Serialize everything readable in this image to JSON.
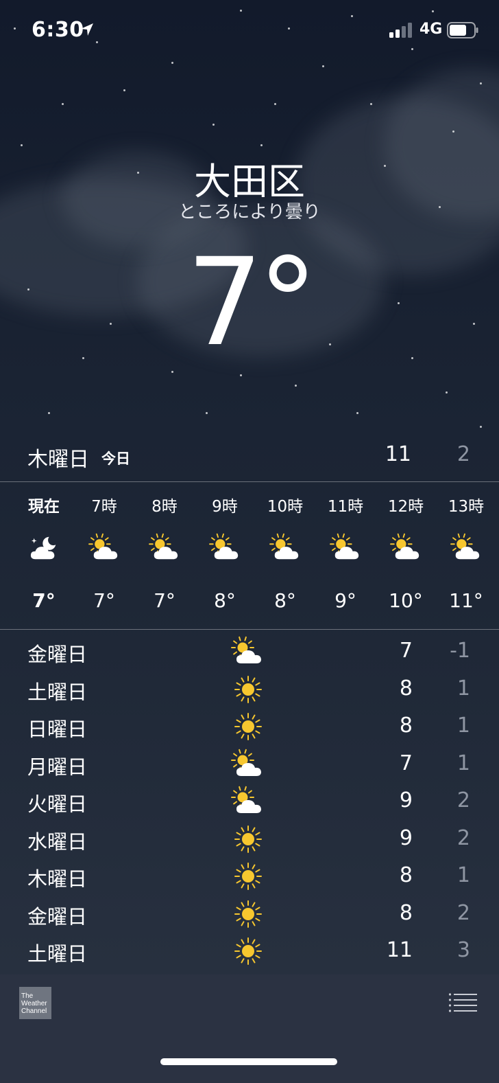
{
  "status_bar": {
    "time": "6:30",
    "network": "4G"
  },
  "location": {
    "city": "大田区",
    "condition": "ところにより曇り",
    "current_temp": "7°"
  },
  "today": {
    "day": "木曜日",
    "tag": "今日",
    "high": "11",
    "low": "2"
  },
  "hourly": [
    {
      "label": "現在",
      "icon": "moon-cloud-icon",
      "temp": "7°",
      "bold": true
    },
    {
      "label": "7時",
      "icon": "sun-cloud-icon",
      "temp": "7°",
      "bold": false
    },
    {
      "label": "8時",
      "icon": "sun-cloud-icon",
      "temp": "7°",
      "bold": false
    },
    {
      "label": "9時",
      "icon": "sun-cloud-icon",
      "temp": "8°",
      "bold": false
    },
    {
      "label": "10時",
      "icon": "sun-cloud-icon",
      "temp": "8°",
      "bold": false
    },
    {
      "label": "11時",
      "icon": "sun-cloud-icon",
      "temp": "9°",
      "bold": false
    },
    {
      "label": "12時",
      "icon": "sun-cloud-icon",
      "temp": "10°",
      "bold": false
    },
    {
      "label": "13時",
      "icon": "sun-cloud-icon",
      "temp": "11°",
      "bold": false
    }
  ],
  "daily": [
    {
      "day": "金曜日",
      "icon": "sun-cloud-icon",
      "high": "7",
      "low": "-1"
    },
    {
      "day": "土曜日",
      "icon": "sun-icon",
      "high": "8",
      "low": "1"
    },
    {
      "day": "日曜日",
      "icon": "sun-icon",
      "high": "8",
      "low": "1"
    },
    {
      "day": "月曜日",
      "icon": "sun-cloud-icon",
      "high": "7",
      "low": "1"
    },
    {
      "day": "火曜日",
      "icon": "sun-cloud-icon",
      "high": "9",
      "low": "2"
    },
    {
      "day": "水曜日",
      "icon": "sun-icon",
      "high": "9",
      "low": "2"
    },
    {
      "day": "木曜日",
      "icon": "sun-icon",
      "high": "8",
      "low": "1"
    },
    {
      "day": "金曜日",
      "icon": "sun-icon",
      "high": "8",
      "low": "2"
    },
    {
      "day": "土曜日",
      "icon": "sun-icon",
      "high": "11",
      "low": "3"
    }
  ],
  "footer": {
    "provider_logo_text": "The Weather Channel"
  },
  "colors": {
    "sun": "#f7c72f",
    "cloud": "#ffffff",
    "low_temp": "#8f96a3"
  }
}
